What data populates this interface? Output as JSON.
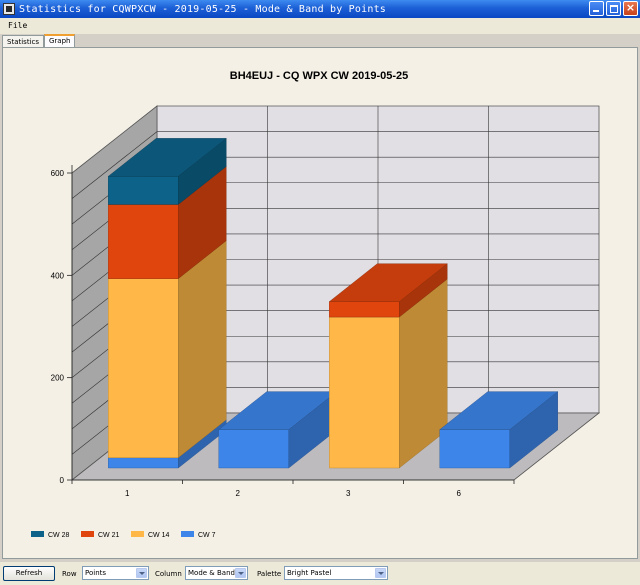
{
  "window": {
    "title": "Statistics for CQWPXCW - 2019-05-25 - Mode & Band by Points"
  },
  "menu": {
    "file": "File"
  },
  "tabs": [
    {
      "label": "Statistics",
      "active": false
    },
    {
      "label": "Graph",
      "active": true
    }
  ],
  "chart_data": {
    "type": "bar",
    "stacked": true,
    "three_d": true,
    "title": "BH4EUJ - CQ WPX  CW 2019-05-25",
    "categories": [
      "1",
      "2",
      "3",
      "6"
    ],
    "series": [
      {
        "name": "CW 7",
        "color": "#3d85e8",
        "values": [
          20,
          75,
          0,
          75
        ]
      },
      {
        "name": "CW 14",
        "color": "#ffb848",
        "values": [
          350,
          0,
          295,
          0
        ]
      },
      {
        "name": "CW 21",
        "color": "#e0450e",
        "values": [
          145,
          0,
          30,
          0
        ]
      },
      {
        "name": "CW 28",
        "color": "#0c6289",
        "values": [
          55,
          0,
          0,
          0
        ]
      }
    ],
    "yticks": [
      0,
      200,
      400,
      600
    ],
    "ylim": [
      0,
      600
    ],
    "grid": true,
    "legend_position": "bottom-left",
    "legend": [
      "CW 28",
      "CW 21",
      "CW 14",
      "CW 7"
    ]
  },
  "controls": {
    "refresh": "Refresh",
    "row_label": "Row",
    "row_value": "Points",
    "column_label": "Column",
    "column_value": "Mode & Band",
    "palette_label": "Palette",
    "palette_value": "Bright Pastel"
  }
}
